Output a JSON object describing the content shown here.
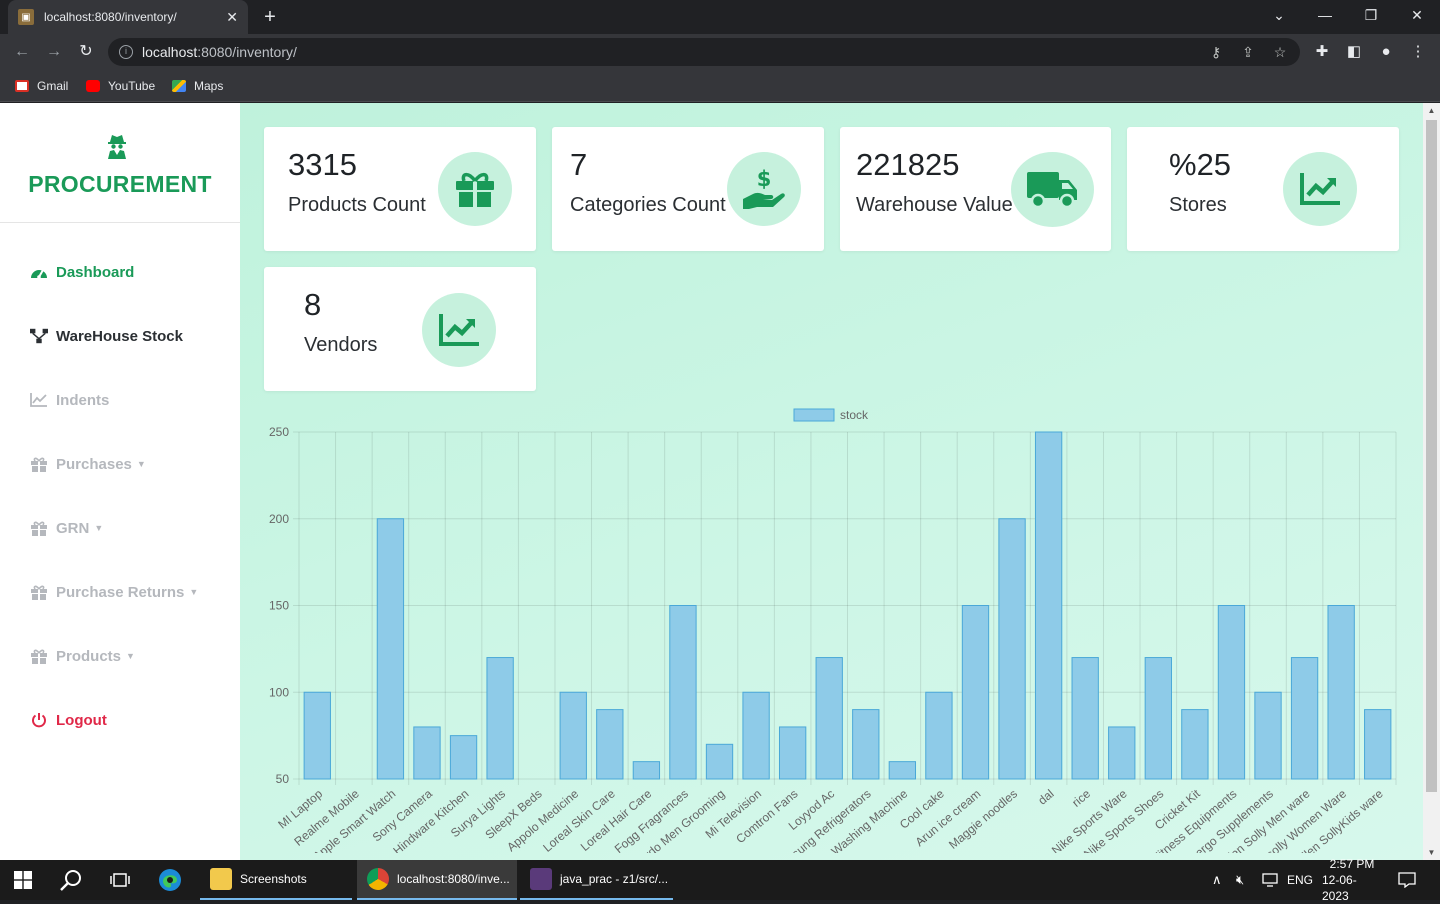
{
  "browser": {
    "tab_title": "localhost:8080/inventory/",
    "url_host": "localhost",
    "url_rest": ":8080/inventory/",
    "bookmarks": [
      "Gmail",
      "YouTube",
      "Maps"
    ]
  },
  "sidebar": {
    "brand": "PROCUREMENT",
    "items": [
      {
        "label": "Dashboard",
        "icon": "tachometer-icon"
      },
      {
        "label": "WareHouse Stock",
        "icon": "sitemap-icon"
      },
      {
        "label": "Indents",
        "icon": "line-chart-icon"
      },
      {
        "label": "Purchases",
        "icon": "gift-icon"
      },
      {
        "label": "GRN",
        "icon": "gift-icon"
      },
      {
        "label": "Purchase Returns",
        "icon": "gift-icon"
      },
      {
        "label": "Products",
        "icon": "gift-icon"
      },
      {
        "label": "Logout",
        "icon": "power-icon"
      }
    ]
  },
  "cards": [
    {
      "value": "3315",
      "label": "Products Count",
      "icon": "gift-icon"
    },
    {
      "value": "7",
      "label": "Categories Count",
      "icon": "hand-dollar-icon"
    },
    {
      "value": "221825",
      "label": "Warehouse Value",
      "icon": "truck-icon"
    },
    {
      "value": "%25",
      "label": "Stores",
      "icon": "chart-line-icon"
    },
    {
      "value": "8",
      "label": "Vendors",
      "icon": "chart-line-icon"
    }
  ],
  "colors": {
    "accent": "#1a9a58",
    "danger": "#e02848",
    "bar_fill": "#8ecbe8",
    "bar_stroke": "#4aa8d8"
  },
  "chart_data": {
    "type": "bar",
    "legend": "stock",
    "legend_position": "top",
    "grid": true,
    "ylim": [
      50,
      250
    ],
    "yticks": [
      50,
      100,
      150,
      200,
      250
    ],
    "categories": [
      "MI Laptop",
      "Realme Mobile",
      "Apple Smart Watch",
      "Sony Camera",
      "Hindware Kitchen",
      "Surya Lights",
      "SleepX Beds",
      "Appolo Medicine",
      "Loreal Skin Care",
      "Loreal Hair Care",
      "Fogg Fragrances",
      "Beardo Men Grooming",
      "Mi Television",
      "Comtron Fans",
      "Loyyod Ac",
      "Samsung Refrigerators",
      "Samsung Washing Machine",
      "Cool cake",
      "Arun ice cream",
      "Maggie noodles",
      "dal",
      "rice",
      "Nike Sports Ware",
      "Nike Sports Shoes",
      "Cricket Kit",
      "Fitness Equipments",
      "Energo Supplements",
      "Allen Solly Men ware",
      "Allen solly Women Ware",
      "Allen SollyKids ware"
    ],
    "values": [
      100,
      50,
      200,
      80,
      75,
      120,
      50,
      100,
      90,
      60,
      150,
      70,
      100,
      80,
      120,
      90,
      60,
      100,
      150,
      200,
      250,
      120,
      80,
      120,
      90,
      150,
      100,
      120,
      150,
      90
    ]
  },
  "taskbar": {
    "apps": [
      "Screenshots",
      "localhost:8080/inve...",
      "java_prac - z1/src/..."
    ],
    "lang": "ENG",
    "time": "2:57 PM",
    "date": "12-06-2023"
  }
}
